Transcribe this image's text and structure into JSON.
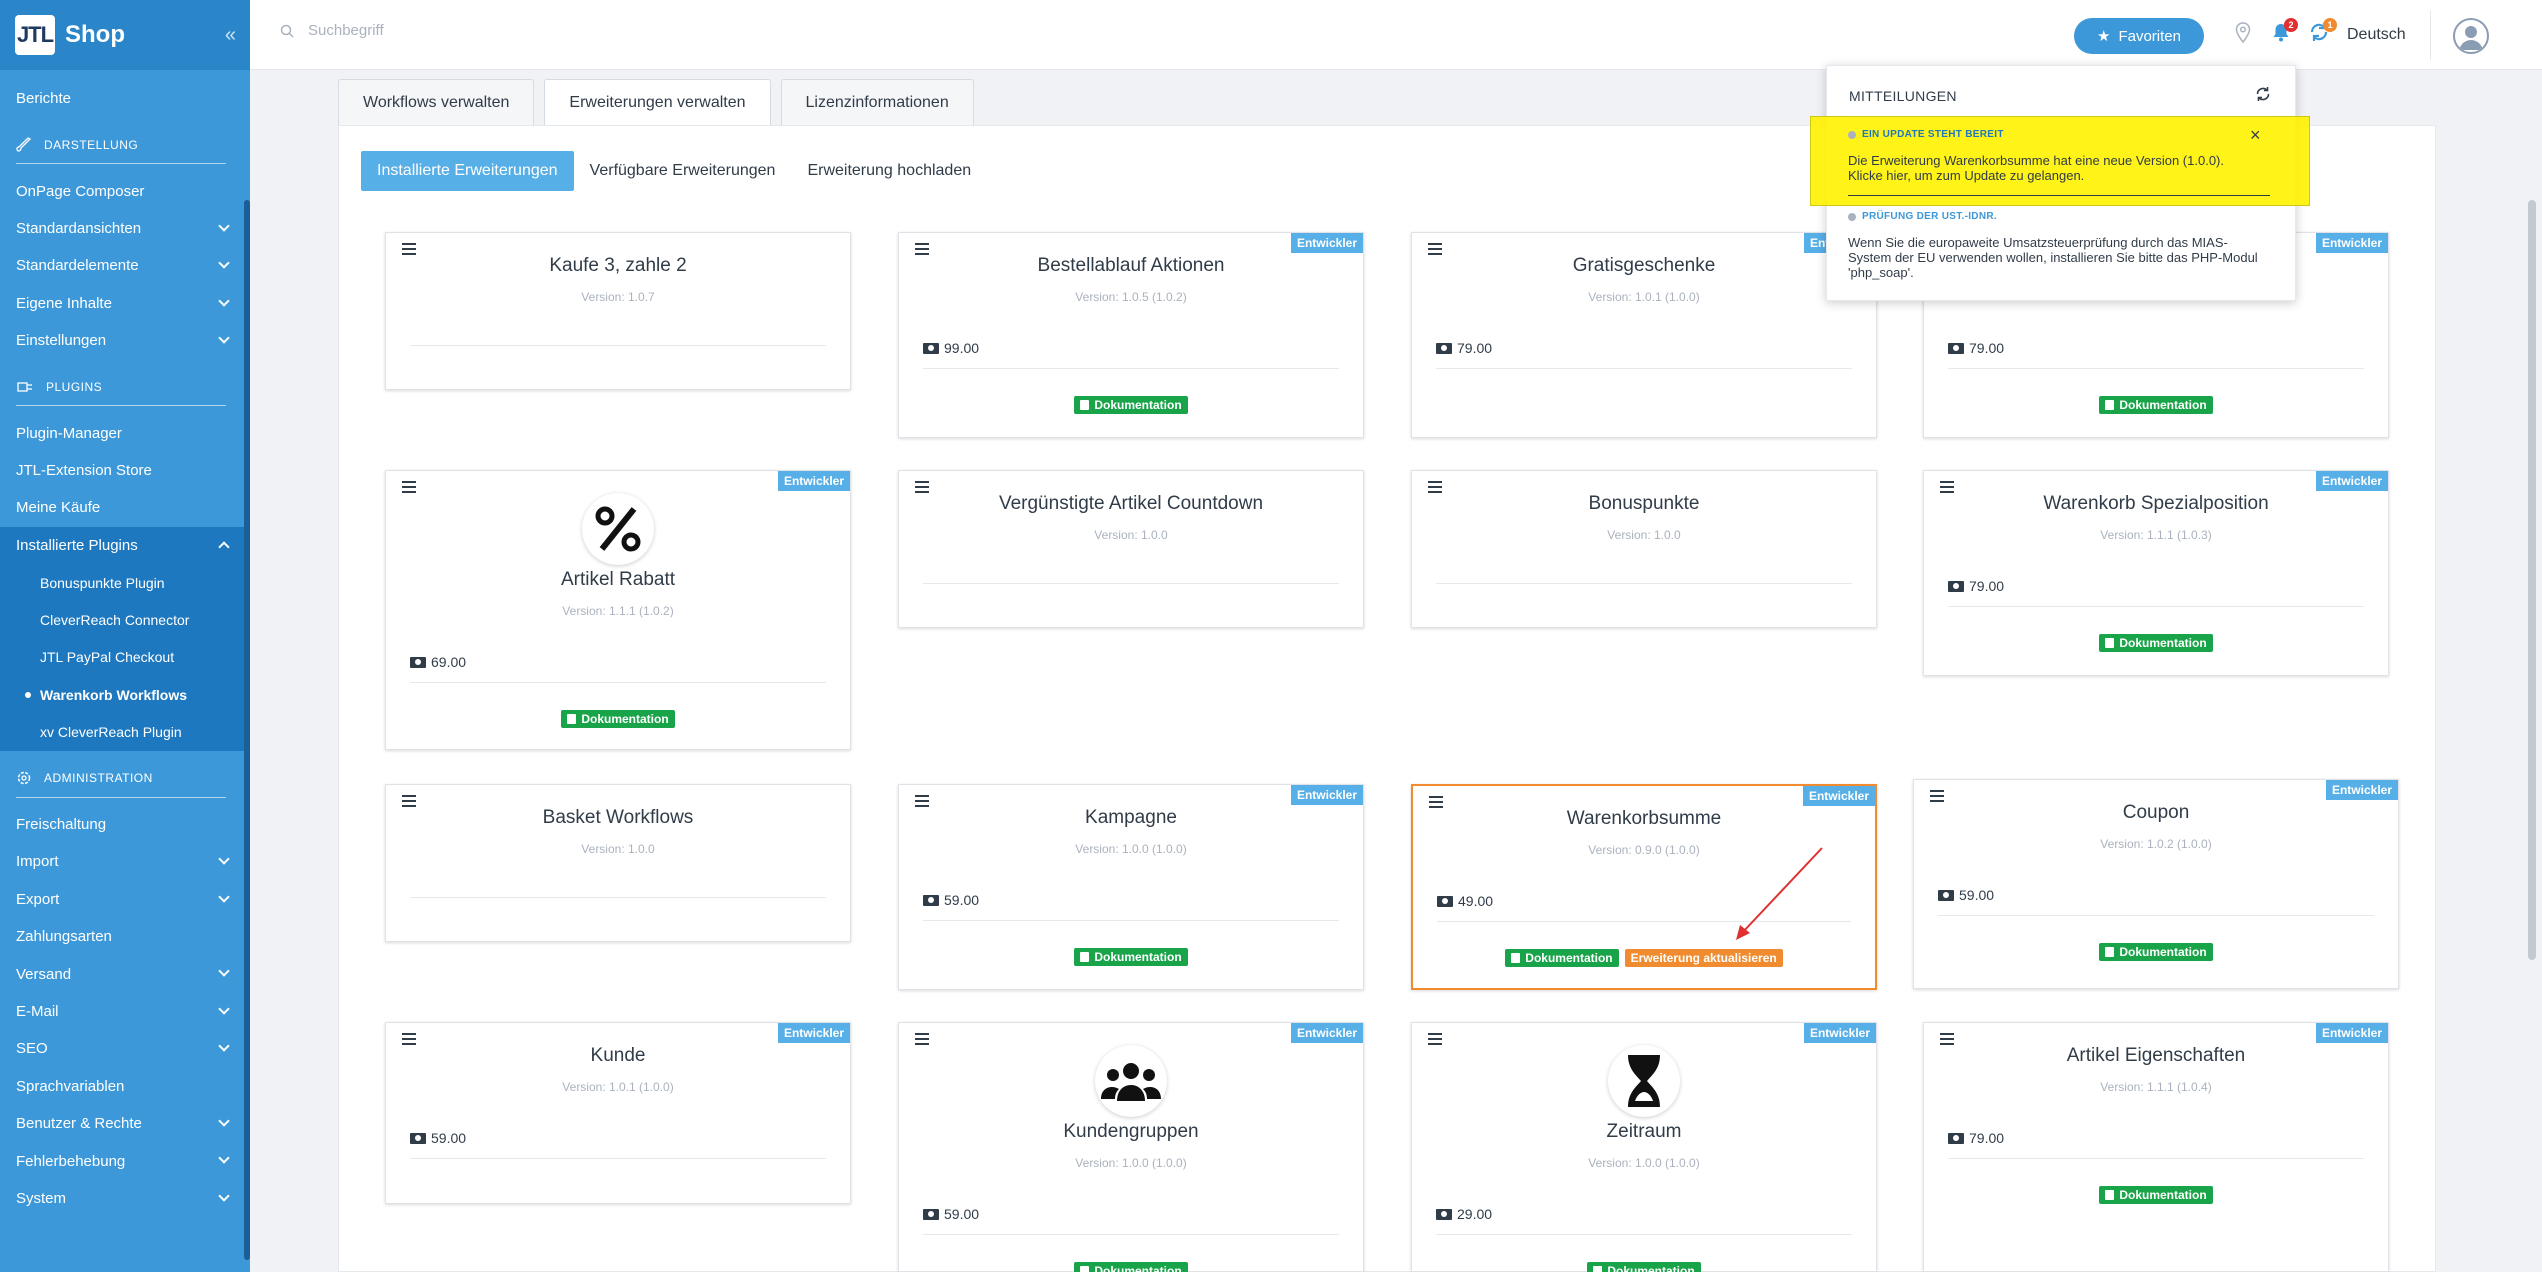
{
  "app": {
    "logo_box": "JTL",
    "logo_text": "Shop",
    "collapse_icon": "«"
  },
  "sidebar": {
    "items": [
      {
        "label": "Berichte",
        "type": "item"
      },
      {
        "label": "DARSTELLUNG",
        "type": "section",
        "icon": "brush-icon"
      },
      {
        "label": "OnPage Composer",
        "type": "item"
      },
      {
        "label": "Standardansichten",
        "type": "item",
        "chevron": "down"
      },
      {
        "label": "Standardelemente",
        "type": "item",
        "chevron": "down"
      },
      {
        "label": "Eigene Inhalte",
        "type": "item",
        "chevron": "down"
      },
      {
        "label": "Einstellungen",
        "type": "item",
        "chevron": "down"
      },
      {
        "label": "PLUGINS",
        "type": "section",
        "icon": "plug-icon"
      },
      {
        "label": "Plugin-Manager",
        "type": "item"
      },
      {
        "label": "JTL-Extension Store",
        "type": "item"
      },
      {
        "label": "Meine Käufe",
        "type": "item"
      },
      {
        "label": "Installierte Plugins",
        "type": "item",
        "chevron": "up",
        "active": true
      },
      {
        "label": "Bonuspunkte Plugin",
        "type": "sub"
      },
      {
        "label": "CleverReach Connector",
        "type": "sub"
      },
      {
        "label": "JTL PayPal Checkout",
        "type": "sub"
      },
      {
        "label": "Warenkorb Workflows",
        "type": "sub",
        "current": true
      },
      {
        "label": "xv CleverReach Plugin",
        "type": "sub"
      },
      {
        "label": "ADMINISTRATION",
        "type": "section",
        "icon": "gear-icon"
      },
      {
        "label": "Freischaltung",
        "type": "item"
      },
      {
        "label": "Import",
        "type": "item",
        "chevron": "down"
      },
      {
        "label": "Export",
        "type": "item",
        "chevron": "down"
      },
      {
        "label": "Zahlungsarten",
        "type": "item"
      },
      {
        "label": "Versand",
        "type": "item",
        "chevron": "down"
      },
      {
        "label": "E-Mail",
        "type": "item",
        "chevron": "down"
      },
      {
        "label": "SEO",
        "type": "item",
        "chevron": "down"
      },
      {
        "label": "Sprachvariablen",
        "type": "item"
      },
      {
        "label": "Benutzer & Rechte",
        "type": "item",
        "chevron": "down"
      },
      {
        "label": "Fehlerbehebung",
        "type": "item",
        "chevron": "down"
      },
      {
        "label": "System",
        "type": "item",
        "chevron": "down"
      }
    ]
  },
  "topbar": {
    "search_placeholder": "Suchbegriff",
    "favorites_label": "Favoriten",
    "notification_count": "2",
    "update_count": "1",
    "language": "Deutsch"
  },
  "tabs": [
    "Workflows verwalten",
    "Erweiterungen verwalten",
    "Lizenzinformationen"
  ],
  "subtabs": [
    "Installierte Erweiterungen",
    "Verfügbare Erweiterungen",
    "Erweiterung hochladen"
  ],
  "cards": [
    {
      "title": "Kaufe 3, zahle 2",
      "version": "Version: 1.0.7"
    },
    {
      "title": "Bestellablauf Aktionen",
      "version": "Version: 1.0.5 (1.0.2)",
      "price": "99.00",
      "dev": "Entwickler",
      "doc": "Dokumentation"
    },
    {
      "title": "Gratisgeschenke",
      "version": "Version: 1.0.1 (1.0.0)",
      "price": "79.00",
      "dev": "Entwickler"
    },
    {
      "title": "",
      "version": "",
      "price": "79.00",
      "dev": "Entwickler",
      "doc": "Dokumentation"
    },
    {
      "title": "Artikel Rabatt",
      "version": "Version: 1.1.1 (1.0.2)",
      "price": "69.00",
      "dev": "Entwickler",
      "doc": "Dokumentation",
      "icon": "percent-icon"
    },
    {
      "title": "Vergünstigte Artikel Countdown",
      "version": "Version: 1.0.0"
    },
    {
      "title": "Bonuspunkte",
      "version": "Version: 1.0.0"
    },
    {
      "title": "Warenkorb Spezialposition",
      "version": "Version: 1.1.1 (1.0.3)",
      "price": "79.00",
      "dev": "Entwickler",
      "doc": "Dokumentation"
    },
    {
      "title": "Basket Workflows",
      "version": "Version: 1.0.0"
    },
    {
      "title": "Kampagne",
      "version": "Version: 1.0.0 (1.0.0)",
      "price": "59.00",
      "dev": "Entwickler",
      "doc": "Dokumentation"
    },
    {
      "title": "Warenkorbsumme",
      "version": "Version: 0.9.0 (1.0.0)",
      "price": "49.00",
      "dev": "Entwickler",
      "doc": "Dokumentation",
      "update": "Erweiterung aktualisieren"
    },
    {
      "title": "Coupon",
      "version": "Version: 1.0.2 (1.0.0)",
      "price": "59.00",
      "dev": "Entwickler",
      "doc": "Dokumentation"
    },
    {
      "title": "Kunde",
      "version": "Version: 1.0.1 (1.0.0)",
      "price": "59.00",
      "dev": "Entwickler"
    },
    {
      "title": "Kundengruppen",
      "version": "Version: 1.0.0 (1.0.0)",
      "price": "59.00",
      "dev": "Entwickler",
      "doc": "Dokumentation",
      "icon": "users-icon"
    },
    {
      "title": "Zeitraum",
      "version": "Version: 1.0.0 (1.0.0)",
      "price": "29.00",
      "dev": "Entwickler",
      "doc": "Dokumentation",
      "icon": "hourglass-icon"
    },
    {
      "title": "Artikel Eigenschaften",
      "version": "Version: 1.1.1 (1.0.4)",
      "price": "79.00",
      "dev": "Entwickler",
      "doc": "Dokumentation"
    }
  ],
  "notifications": {
    "title": "MITTEILUNGEN",
    "items": [
      {
        "heading": "EIN UPDATE STEHT BEREIT",
        "text": "Die Erweiterung Warenkorbsumme hat eine neue Version (1.0.0). Klicke hier, um zum Update zu gelangen.",
        "color": "#1e78bf"
      },
      {
        "heading": "PRÜFUNG DER UST.-IDNR.",
        "text": "Wenn Sie die europaweite Umsatzsteuerprüfung durch das MIAS-System der EU verwenden wollen, installieren Sie bitte das PHP-Modul 'php_soap'.",
        "color": "#3d98d9"
      }
    ]
  },
  "colors": {
    "accent": "#3d98d9",
    "doc": "#1aa44a",
    "update": "#f08c2f",
    "highlight": "#fff200"
  }
}
